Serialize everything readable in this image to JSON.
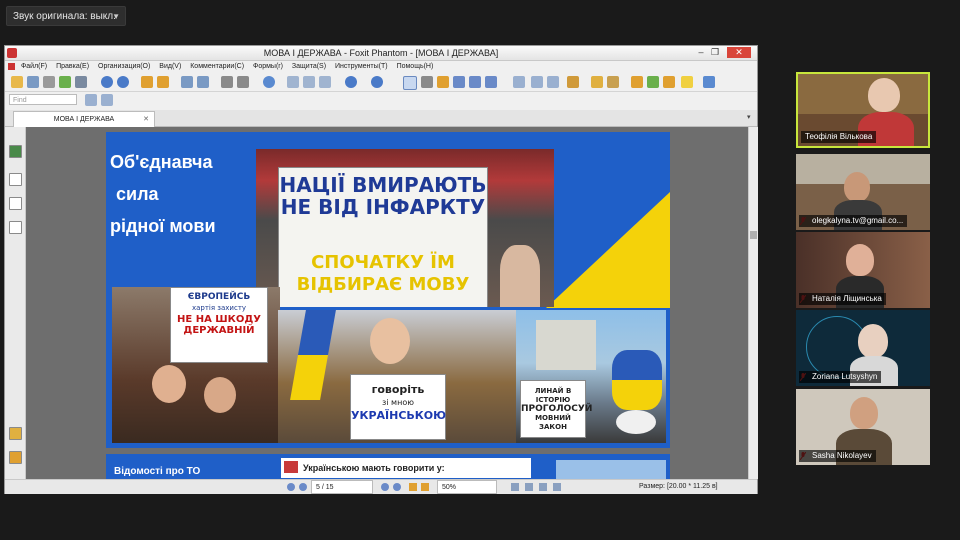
{
  "audio_dropdown": {
    "label": "Звук оригинала: выкл."
  },
  "window": {
    "title": "МОВА І ДЕРЖАВА - Foxit Phantom - [МОВА І ДЕРЖАВА]",
    "menu": [
      "Файл(F)",
      "Правка(E)",
      "Организация(O)",
      "Вид(V)",
      "Комментарии(C)",
      "Формы(r)",
      "Защита(S)",
      "Инструменты(T)",
      "Помощь(H)"
    ],
    "page_field_placeholder": "Find",
    "tab_label": "МОВА І ДЕРЖАВА"
  },
  "slide": {
    "title_lines": [
      "Об'єднавча",
      "сила",
      "рідної мови"
    ],
    "main_sign_line1": "НАЦІЇ ВМИРАЮТЬ НЕ ВІД ІНФАРКТУ",
    "main_sign_line2": "СПОЧАТКУ ЇМ ВІДБИРАЄ МОВУ",
    "left_sign_line1": "ЄВРОПЕЙСЬ",
    "left_sign_line2": "хартія захисту",
    "left_sign_line3": "НЕ НА ШКОДУ",
    "left_sign_line4": "ДЕРЖАВНІЙ",
    "center_sign_line1": "говоріть",
    "center_sign_line2": "зі мною",
    "center_sign_line3": "УКРАЇНСЬКОЮ",
    "right_sign_line1": "ЛИНАЙ В ІСТОРІЮ",
    "right_sign_line2": "ПРОГОЛОСУЙ",
    "right_sign_line3": "МОВНИЙ ЗАКОН"
  },
  "next_slide": {
    "left_text": "Відомості про ТО",
    "box_text": "Українською мають говорити у:"
  },
  "status": {
    "page_indicator": "5 / 15",
    "zoom": "50%",
    "size_label": "Размер: [20.00 * 11.25 в]"
  },
  "participants": [
    {
      "name": "Теофілія Вількова",
      "active": true,
      "muted": false
    },
    {
      "name": "olegkalyna.tv@gmail.co...",
      "active": false,
      "muted": true
    },
    {
      "name": "Наталія Ліщинська",
      "active": false,
      "muted": true
    },
    {
      "name": "Zoriana Lutsyshyn",
      "active": false,
      "muted": true
    },
    {
      "name": "Sasha Nikolayev",
      "active": false,
      "muted": true
    }
  ],
  "colors": {
    "slide_blue": "#1f5fc8",
    "flag_yellow": "#f4d20a",
    "active_speaker_border": "#c8e63c",
    "muted_red": "#e03232"
  }
}
